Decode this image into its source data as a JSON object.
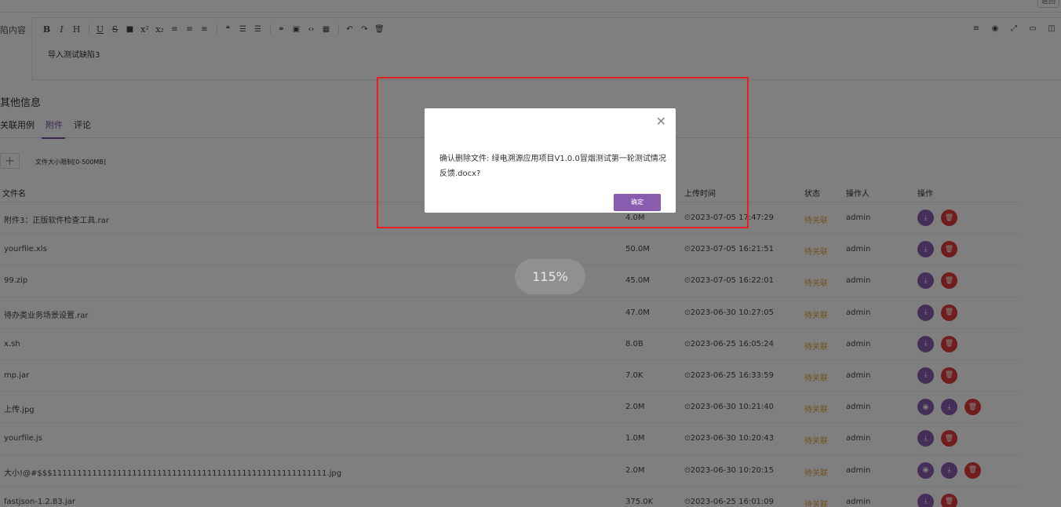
{
  "header": {
    "top_right_button": "返回"
  },
  "editor": {
    "field_label": "陷内容",
    "content": "导入测试缺陷3"
  },
  "section": {
    "title": "其他信息",
    "tabs": [
      {
        "label": "关联用例"
      },
      {
        "label": "附件"
      },
      {
        "label": "评论"
      }
    ],
    "active_tab": "附件"
  },
  "attachments": {
    "add_icon": "plus-icon",
    "size_hint": "文件大小限制[0-500MB]",
    "columns": {
      "name": "文件名",
      "time": "上传时间",
      "status": "状态",
      "operator": "操作人",
      "actions": "操作"
    },
    "rows": [
      {
        "name": "附件3：正版软件检查工具.rar",
        "size": "4.0M",
        "time": "2023-07-05 17:47:29",
        "status": "待关联",
        "operator": "admin"
      },
      {
        "name": "yourfile.xls",
        "size": "50.0M",
        "time": "2023-07-05 16:21:51",
        "status": "待关联",
        "operator": "admin"
      },
      {
        "name": "99.zip",
        "size": "45.0M",
        "time": "2023-07-05 16:22:01",
        "status": "待关联",
        "operator": "admin"
      },
      {
        "name": "待办类业务场景设置.rar",
        "size": "47.0M",
        "time": "2023-06-30 10:27:05",
        "status": "待关联",
        "operator": "admin"
      },
      {
        "name": "x.sh",
        "size": "8.0B",
        "time": "2023-06-25 16:05:24",
        "status": "待关联",
        "operator": "admin"
      },
      {
        "name": "mp.jar",
        "size": "7.0K",
        "time": "2023-06-25 16:33:59",
        "status": "待关联",
        "operator": "admin"
      },
      {
        "name": "上传.jpg",
        "size": "2.0M",
        "time": "2023-06-30 10:21:40",
        "status": "待关联",
        "operator": "admin"
      },
      {
        "name": "yourfile.js",
        "size": "1.0M",
        "time": "2023-06-30 10:20:43",
        "status": "待关联",
        "operator": "admin"
      },
      {
        "name": "大小!@#$$$1111111111111111111111111111111111111111111111111111111.jpg",
        "size": "2.0M",
        "time": "2023-06-30 10:20:15",
        "status": "待关联",
        "operator": "admin"
      },
      {
        "name": "fastjson-1.2.83.jar",
        "size": "375.0K",
        "time": "2023-06-25 16:01:09",
        "status": "待关联",
        "operator": "admin"
      }
    ]
  },
  "dialog": {
    "message": "确认删除文件: 绿电溯源应用项目V1.0.0冒烟测试第一轮测试情况反馈.docx?",
    "confirm_label": "确定",
    "close_icon": "close-icon"
  },
  "zoom_indicator": "115%",
  "colors": {
    "accent": "#8a5cb0",
    "danger": "#e23a3a",
    "status_pending": "#e6a23c",
    "annotation_box": "#e62020"
  }
}
